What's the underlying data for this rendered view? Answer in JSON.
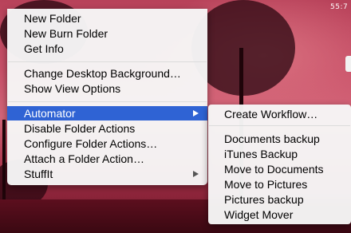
{
  "clock": {
    "text": "55:7"
  },
  "context_menu": {
    "items": [
      {
        "label": "New Folder"
      },
      {
        "label": "New Burn Folder"
      },
      {
        "label": "Get Info"
      },
      {
        "label": "Change Desktop Background…"
      },
      {
        "label": "Show View Options"
      },
      {
        "label": "Automator",
        "selected": true,
        "has_submenu": true
      },
      {
        "label": "Disable Folder Actions"
      },
      {
        "label": "Configure Folder Actions…"
      },
      {
        "label": "Attach a Folder Action…"
      },
      {
        "label": "StuffIt",
        "has_submenu": true
      }
    ]
  },
  "automator_submenu": {
    "items": [
      {
        "label": "Create Workflow…"
      },
      {
        "label": "Documents backup"
      },
      {
        "label": "iTunes Backup"
      },
      {
        "label": "Move to Documents"
      },
      {
        "label": "Move to Pictures"
      },
      {
        "label": "Pictures backup"
      },
      {
        "label": "Widget Mover"
      }
    ]
  },
  "colors": {
    "selection": "#2f63d4",
    "menu_background": "#f6f6f6",
    "desktop_accent": "#c85068"
  }
}
